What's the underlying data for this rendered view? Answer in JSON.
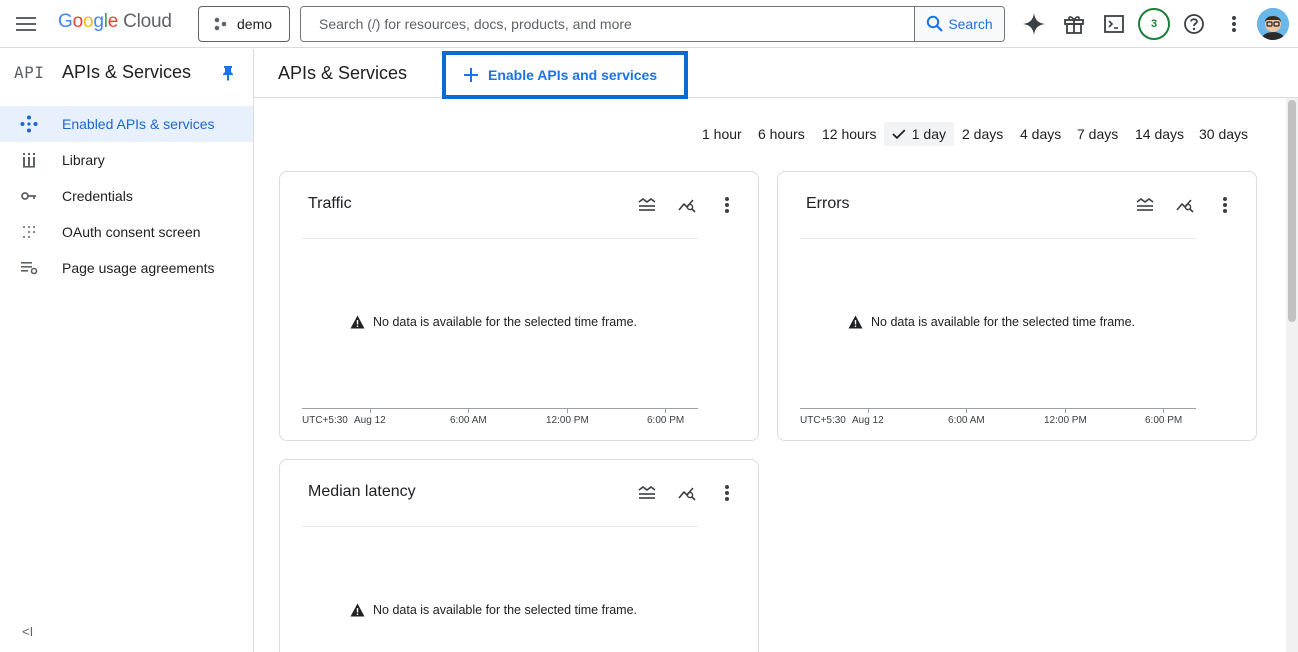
{
  "topbar": {
    "logo_google": [
      "G",
      "o",
      "o",
      "g",
      "l",
      "e"
    ],
    "logo_cloud": "Cloud",
    "project": "demo",
    "search_placeholder": "Search (/) for resources, docs, products, and more",
    "search_button": "Search",
    "notification_count": "3"
  },
  "sidebar": {
    "api_mark": "API",
    "title": "APIs & Services",
    "items": [
      {
        "label": "Enabled APIs & services",
        "icon": "diamond-dots-icon"
      },
      {
        "label": "Library",
        "icon": "library-grid-icon"
      },
      {
        "label": "Credentials",
        "icon": "key-icon"
      },
      {
        "label": "OAuth consent screen",
        "icon": "consent-dots-icon"
      },
      {
        "label": "Page usage agreements",
        "icon": "list-settings-icon"
      }
    ],
    "collapse_label": "<I"
  },
  "main": {
    "title": "APIs & Services",
    "enable_button": "Enable APIs and services",
    "time_ranges": [
      "1 hour",
      "6 hours",
      "12 hours",
      "1 day",
      "2 days",
      "4 days",
      "7 days",
      "14 days",
      "30 days"
    ],
    "selected_range": "1 day"
  },
  "cards": [
    {
      "title": "Traffic",
      "message": "No data is available for the selected time frame.",
      "axis": {
        "tz": "UTC+5:30",
        "labels": [
          "Aug 12",
          "6:00 AM",
          "12:00 PM",
          "6:00 PM"
        ]
      }
    },
    {
      "title": "Errors",
      "message": "No data is available for the selected time frame.",
      "axis": {
        "tz": "UTC+5:30",
        "labels": [
          "Aug 12",
          "6:00 AM",
          "12:00 PM",
          "6:00 PM"
        ]
      }
    },
    {
      "title": "Median latency",
      "message": "No data is available for the selected time frame."
    }
  ],
  "colors": {
    "accent": "#1a73e8",
    "active_bg": "#e8f0fe",
    "highlight_border": "#0b6bd3",
    "success": "#188038"
  }
}
